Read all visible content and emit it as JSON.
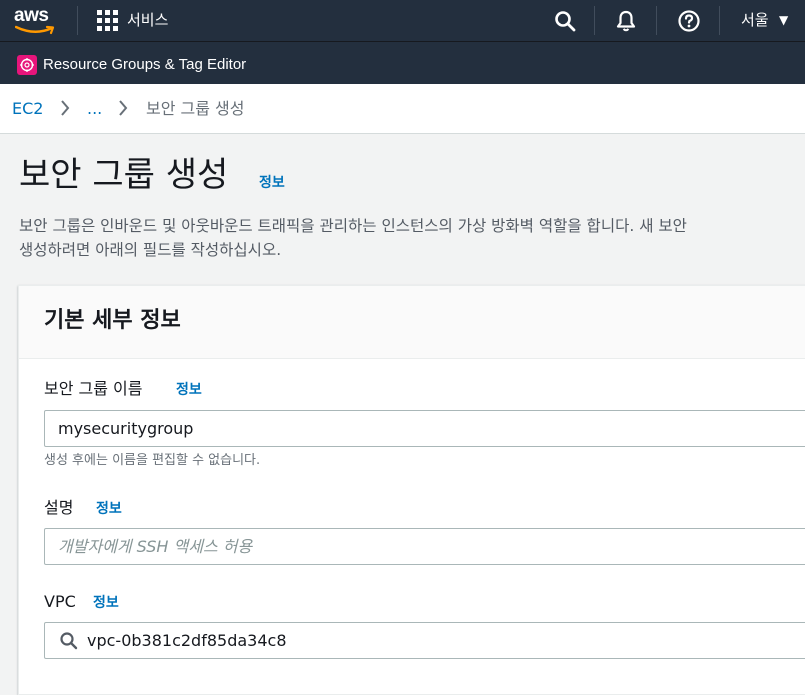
{
  "topbar": {
    "logo_text": "aws",
    "services_label": "서비스",
    "icons": [
      "search-icon",
      "bell-icon",
      "help-icon"
    ],
    "region_label": "서울",
    "region_caret": "▼"
  },
  "subbar": {
    "app_icon": "resource-groups-icon",
    "app_label": "Resource Groups & Tag Editor"
  },
  "breadcrumb": {
    "items": [
      "EC2",
      "...",
      "보안 그룹 생성"
    ]
  },
  "header": {
    "title": "보안 그룹 생성",
    "info_link": "정보",
    "description_line1": "보안 그룹은 인바운드 및 아웃바운드 트래픽을 관리하는 인스턴스의 가상 방화벽 역할을 합니다. 새 보안",
    "description_line2": "생성하려면 아래의 필드를 작성하십시오."
  },
  "panel": {
    "title": "기본 세부 정보",
    "fields": {
      "name": {
        "label": "보안 그룹 이름",
        "info_link": "정보",
        "value": "mysecuritygroup",
        "constraint": "생성 후에는 이름을 편집할 수 없습니다."
      },
      "description": {
        "label": "설명",
        "info_link": "정보",
        "placeholder": "개발자에게 SSH 액세스 허용"
      },
      "vpc": {
        "label": "VPC",
        "info_link": "정보",
        "value": "vpc-0b381c2df85da34c8"
      }
    }
  },
  "colors": {
    "navbar": "#232f3e",
    "link": "#0073bb",
    "accent_orange": "#ff9900",
    "resource_groups_pink": "#e7157b",
    "page_bg": "#f2f3f3"
  }
}
